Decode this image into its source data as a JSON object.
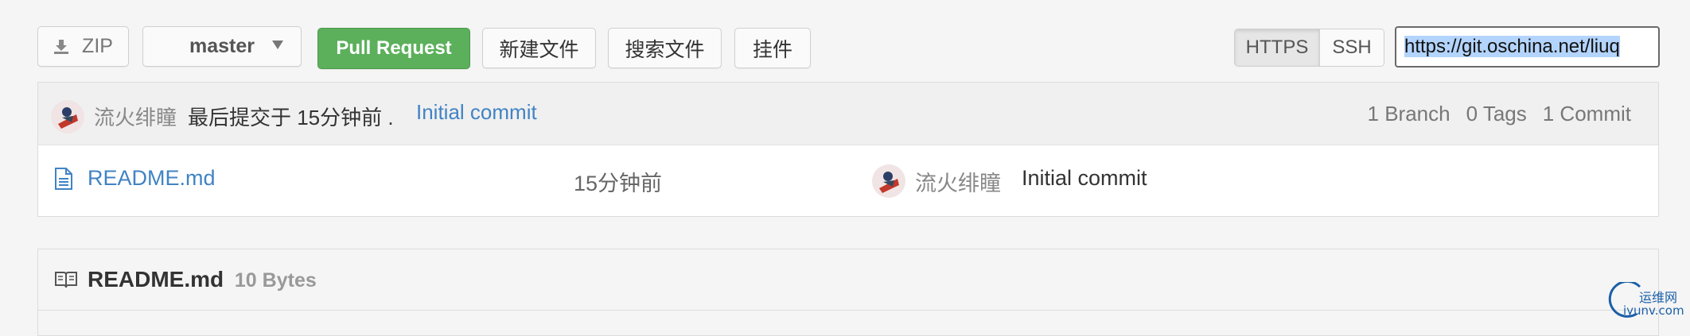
{
  "toolbar": {
    "zip_label": "ZIP",
    "branch_label": "master",
    "pull_request_label": "Pull Request",
    "new_file_label": "新建文件",
    "search_file_label": "搜索文件",
    "widget_label": "挂件",
    "protocols": [
      "HTTPS",
      "SSH"
    ],
    "selected_protocol": "HTTPS",
    "clone_url": "https://git.oschina.net/liuq"
  },
  "last_commit": {
    "author": "流火绯瞳",
    "text": "最后提交于 15分钟前 .",
    "message": "Initial commit",
    "branches": "1 Branch",
    "tags": "0 Tags",
    "commits": "1 Commit"
  },
  "files": [
    {
      "name": "README.md",
      "time": "15分钟前",
      "author": "流火绯瞳",
      "message": "Initial commit"
    }
  ],
  "readme": {
    "title": "README.md",
    "size": "10 Bytes"
  },
  "watermark": {
    "cn": "运维网",
    "en": "iyunv.com"
  },
  "colors": {
    "accent_green": "#5cb05b",
    "link_blue": "#4183c4",
    "selection": "#b3d4fc"
  }
}
